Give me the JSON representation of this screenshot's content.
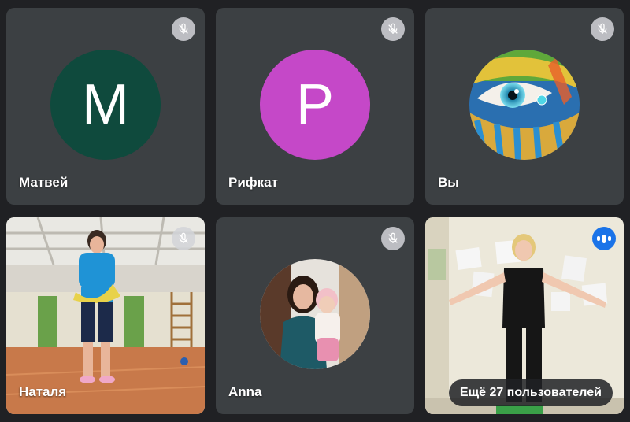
{
  "participants": [
    {
      "name": "Матвей",
      "initial": "М",
      "avatar_color": "#0f4a3d",
      "muted": true
    },
    {
      "name": "Рифкат",
      "initial": "Р",
      "avatar_color": "#c548c8",
      "muted": true
    },
    {
      "name": "Вы",
      "muted": true
    },
    {
      "name": "Наталя",
      "muted": true
    },
    {
      "name": "Anna",
      "muted": true
    },
    {
      "name": "",
      "speaking": true
    }
  ],
  "more_participants_label": "Ещё 27 пользователей",
  "colors": {
    "tile_bg": "#3c4043",
    "page_bg": "#202124",
    "speaking_accent": "#1a73e8"
  }
}
